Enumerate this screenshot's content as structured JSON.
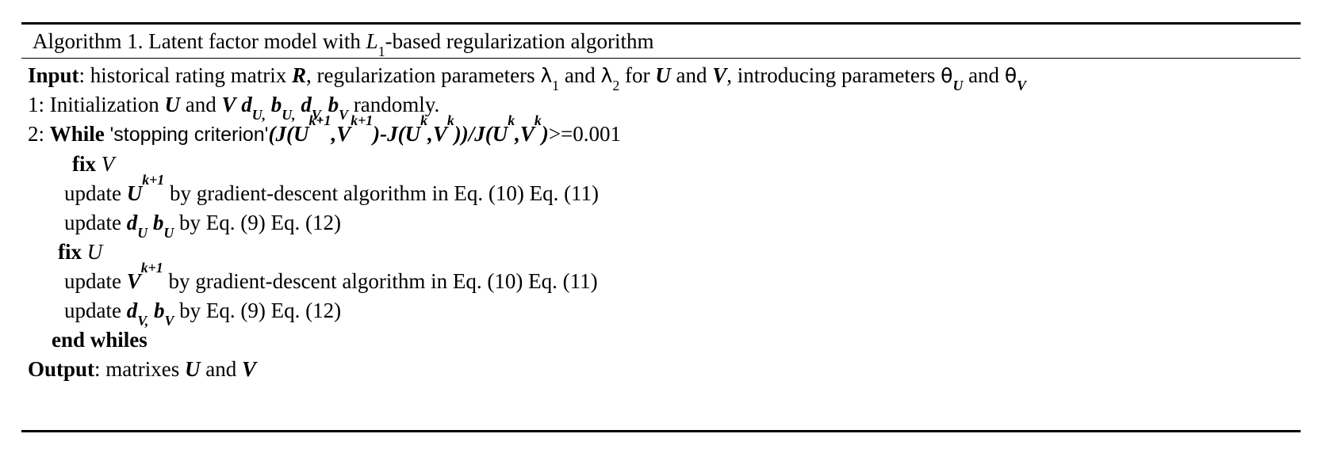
{
  "algorithm": {
    "title_prefix": "Algorithm 1. Latent factor model with ",
    "title_math_L": "L",
    "title_math_sub": "1",
    "title_suffix": "-based regularization algorithm",
    "lines": {
      "input_label": "Input",
      "input_text_1": ": historical rating matrix ",
      "input_var_R": "R",
      "input_text_2": ", regularization parameters ",
      "input_lambda1": "λ",
      "input_lambda1_sub": "1",
      "input_text_3": " and ",
      "input_lambda2": "λ",
      "input_lambda2_sub": "2",
      "input_text_4": " for ",
      "input_var_U": "U",
      "input_text_5": " and ",
      "input_var_V": "V",
      "input_text_6": ", introducing parameters ",
      "input_theta_U": "θ",
      "input_theta_U_sub": "U",
      "input_text_7": " and ",
      "input_theta_V": "θ",
      "input_theta_V_sub": "V",
      "l1_num": "1: ",
      "l1_text_1": "Initialization ",
      "l1_var_U": "U",
      "l1_text_2": " and ",
      "l1_var_V": "V",
      "l1_vars": "d",
      "l1_vars_sub1": "U,",
      "l1_varb": "b",
      "l1_varb_sub1": "U,",
      "l1_vard2": "d",
      "l1_vard2_sub": "V,",
      "l1_varb2": "b",
      "l1_varb2_sub": "V",
      "l1_text_3": " randomly.",
      "l2_num": "2: ",
      "l2_while": "While",
      "l2_criterion": "'stopping criterion'",
      "l2_expr_open": "(",
      "l2_J1": "J",
      "l2_J1_args_open": "(",
      "l2_U1": "U",
      "l2_U1_sup": "k+1",
      "l2_comma1": ",",
      "l2_V1": "V",
      "l2_V1_sup": "k+1",
      "l2_close1": ")",
      "l2_minus": "-",
      "l2_J2": "J",
      "l2_J2_open": "(",
      "l2_U2": "U",
      "l2_U2_sup": "k",
      "l2_comma2": ",",
      "l2_V2": "V",
      "l2_V2_sup": "k",
      "l2_close2": "))",
      "l2_slash": "/",
      "l2_J3": "J",
      "l2_J3_open": "(",
      "l2_U3": "U",
      "l2_U3_sup": "k",
      "l2_comma3": ",",
      "l2_V3": "V",
      "l2_V3_sup": "k",
      "l2_close3": ")",
      "l2_cond": ">=0.001",
      "fixV_label": "fix",
      "fixV_var": "V",
      "updU_text_1": "update ",
      "updU_var": "U",
      "updU_sup": "k+1",
      "updU_text_2": " by gradient-descent algorithm in Eq. (10) Eq. (11)",
      "updDU_text_1": "update ",
      "updDU_d": "d",
      "updDU_d_sub": "U",
      "updDU_b": "b",
      "updDU_b_sub": "U",
      "updDU_text_2": " by Eq. (9) Eq. (12)",
      "fixU_label": "fix",
      "fixU_var": "U",
      "updV_text_1": "update ",
      "updV_var": "V",
      "updV_sup": "k+1",
      "updV_text_2": " by gradient-descent algorithm in Eq. (10) Eq. (11)",
      "updDV_text_1": "update ",
      "updDV_d": "d",
      "updDV_d_sub": "V,",
      "updDV_b": "b",
      "updDV_b_sub": "V",
      "updDV_text_2": " by Eq. (9) Eq. (12)",
      "end_while": "end whiles",
      "output_label": "Output",
      "output_text_1": ": matrixes ",
      "output_var_U": "U",
      "output_text_2": " and ",
      "output_var_V": "V"
    }
  }
}
